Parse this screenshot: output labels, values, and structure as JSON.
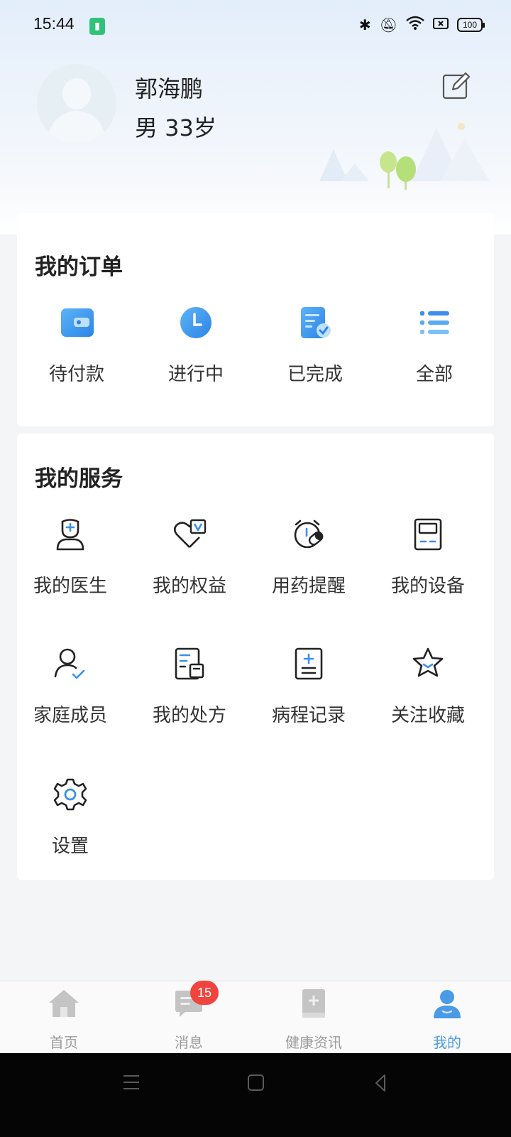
{
  "status_bar": {
    "time": "15:44",
    "battery_level": "100"
  },
  "profile": {
    "name": "郭海鹏",
    "info": "男 33岁"
  },
  "orders": {
    "title": "我的订单",
    "items": [
      {
        "label": "待付款",
        "icon": "wallet-icon"
      },
      {
        "label": "进行中",
        "icon": "clock-icon"
      },
      {
        "label": "已完成",
        "icon": "document-check-icon"
      },
      {
        "label": "全部",
        "icon": "list-icon"
      }
    ]
  },
  "services": {
    "title": "我的服务",
    "items": [
      {
        "label": "我的医生",
        "icon": "doctor-icon"
      },
      {
        "label": "我的权益",
        "icon": "vip-heart-icon"
      },
      {
        "label": "用药提醒",
        "icon": "pill-alarm-icon"
      },
      {
        "label": "我的设备",
        "icon": "device-icon"
      },
      {
        "label": "家庭成员",
        "icon": "family-member-icon"
      },
      {
        "label": "我的处方",
        "icon": "prescription-icon"
      },
      {
        "label": "病程记录",
        "icon": "medical-record-icon"
      },
      {
        "label": "关注收藏",
        "icon": "star-icon"
      },
      {
        "label": "设置",
        "icon": "settings-gear-icon"
      }
    ]
  },
  "tabbar": {
    "items": [
      {
        "label": "首页",
        "icon": "home-icon"
      },
      {
        "label": "消息",
        "icon": "message-icon"
      },
      {
        "label": "健康资讯",
        "icon": "health-news-icon"
      },
      {
        "label": "我的",
        "icon": "me-icon"
      }
    ],
    "active_index": 3,
    "message_badge": "15"
  },
  "colors": {
    "accent": "#4a9ae6",
    "badge": "#f0443e",
    "inactive_tab": "#9a9a9a"
  }
}
